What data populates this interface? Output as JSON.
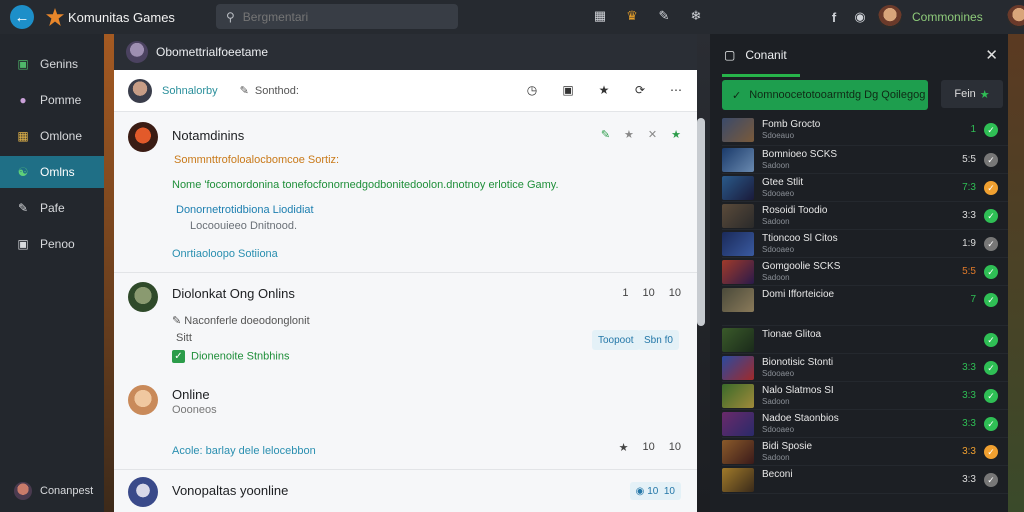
{
  "app": {
    "title": "Komunitas Games"
  },
  "search": {
    "placeholder": "Bergmentari"
  },
  "topbar_icons": [
    "grid-icon",
    "trophy-icon",
    "edit-icon",
    "settings-icon"
  ],
  "topbar_right": {
    "user_name": "Commonines"
  },
  "sidebar": {
    "items": [
      {
        "label": "Genins",
        "icon": "gamepad-icon"
      },
      {
        "label": "Pomme",
        "icon": "user-icon"
      },
      {
        "label": "Omlone",
        "icon": "chat-icon"
      },
      {
        "label": "Omlns",
        "icon": "people-icon",
        "active": true
      },
      {
        "label": "Pafe",
        "icon": "pen-icon"
      },
      {
        "label": "Penoo",
        "icon": "photo-icon"
      }
    ],
    "bottom_label": "Conanpest"
  },
  "main": {
    "header_title": "Obomettrialfoeetame",
    "toolbar": {
      "status": "Sohnalorby",
      "sort": "Sonthod:"
    },
    "posts": [
      {
        "title": "Notamdinins",
        "lines": [
          {
            "text": "Sommnttrofoloalocbomcoe Sortiz:",
            "color": "#c97a1a"
          },
          {
            "text": "Nome 'focomordonina tonefocfonornedgodbonitedoolon.dnotnoy erlotice Gamy.",
            "color": "#1f8f3a"
          },
          {
            "text": "Donornetrotidbiona Liodidiat",
            "color": "#1d7fb0"
          },
          {
            "text": "Locoouieeo Dnitnood.",
            "color": "#6a7077"
          },
          {
            "text": "Onrtiaoloopo Sotiiona",
            "color": "#2a8fb0"
          }
        ]
      },
      {
        "title": "Diolonkat Ong Onlins",
        "meta": [
          "1",
          "10",
          "10"
        ],
        "lines": [
          {
            "text": "Naconferle doeodonglonit",
            "color": "#555555"
          },
          {
            "text": "Sitt",
            "color": "#555555"
          },
          {
            "text": "Dionenoite Stnbhins",
            "color": "#1f8f3a"
          }
        ],
        "tags": [
          "Toopoot",
          "Sbn  f0"
        ]
      },
      {
        "title": "Online",
        "subtitle": "Oooneos",
        "footer": "Acole: barlay dele lelocebbon",
        "meta": [
          "10",
          "10"
        ]
      },
      {
        "title": "Vonopaltas yoonline",
        "meta": [
          "10",
          "10"
        ]
      }
    ]
  },
  "right_panel": {
    "title": "Conanit",
    "join_label": "Nomnoocetotooarmtdg Dg Qoilegog",
    "small_btn": "Fein",
    "rows": [
      {
        "name": "Fomb Grocto",
        "sub": "Sdoeauo",
        "score": "1",
        "score_color": "#2fbf55",
        "badge_color": "#2fbf55"
      },
      {
        "name": "Bomnioeo SCKS",
        "sub": "Sadoon",
        "score": "5:5",
        "score_color": "#dcdcdc",
        "badge_color": "#777777"
      },
      {
        "name": "Gtee Stlit",
        "sub": "Sdooaeo",
        "score": "7:3",
        "score_color": "#2fbf55",
        "badge_color": "#f0a030"
      },
      {
        "name": "Rosoidi Toodio",
        "sub": "Sadoon",
        "score": "3:3",
        "score_color": "#dcdcdc",
        "badge_color": "#2fbf55"
      },
      {
        "name": "Ttioncoo Sl Citos",
        "sub": "Sdooaeo",
        "score": "1:9",
        "score_color": "#dcdcdc",
        "badge_color": "#777777"
      },
      {
        "name": "Gomgoolie SCKS",
        "sub": "Sadoon",
        "score": "5:5",
        "score_color": "#e07a2a",
        "badge_color": "#2fbf55"
      },
      {
        "name": "Domi Ifforteicioe",
        "sub": "",
        "score": "7",
        "score_color": "#2fbf55",
        "badge_color": "#2fbf55"
      },
      {
        "name": "Tionae Glitoa",
        "sub": "",
        "score": "",
        "score_color": "#2fbf55",
        "badge_color": "#2fbf55"
      },
      {
        "name": "Bionotisic Stonti",
        "sub": "Sdooaeo",
        "score": "3:3",
        "score_color": "#2fbf55",
        "badge_color": "#2fbf55"
      },
      {
        "name": "Nalo Slatmos SI",
        "sub": "Sadoon",
        "score": "3:3",
        "score_color": "#2fbf55",
        "badge_color": "#2fbf55"
      },
      {
        "name": "Nadoe Staonbios",
        "sub": "Sdooaeo",
        "score": "3:3",
        "score_color": "#2fbf55",
        "badge_color": "#2fbf55"
      },
      {
        "name": "Bidi Sposie",
        "sub": "Sadoon",
        "score": "3:3",
        "score_color": "#f0a030",
        "badge_color": "#f0a030"
      },
      {
        "name": "Beconi",
        "sub": "",
        "score": "3:3",
        "score_color": "#dcdcdc",
        "badge_color": "#777777"
      }
    ]
  }
}
